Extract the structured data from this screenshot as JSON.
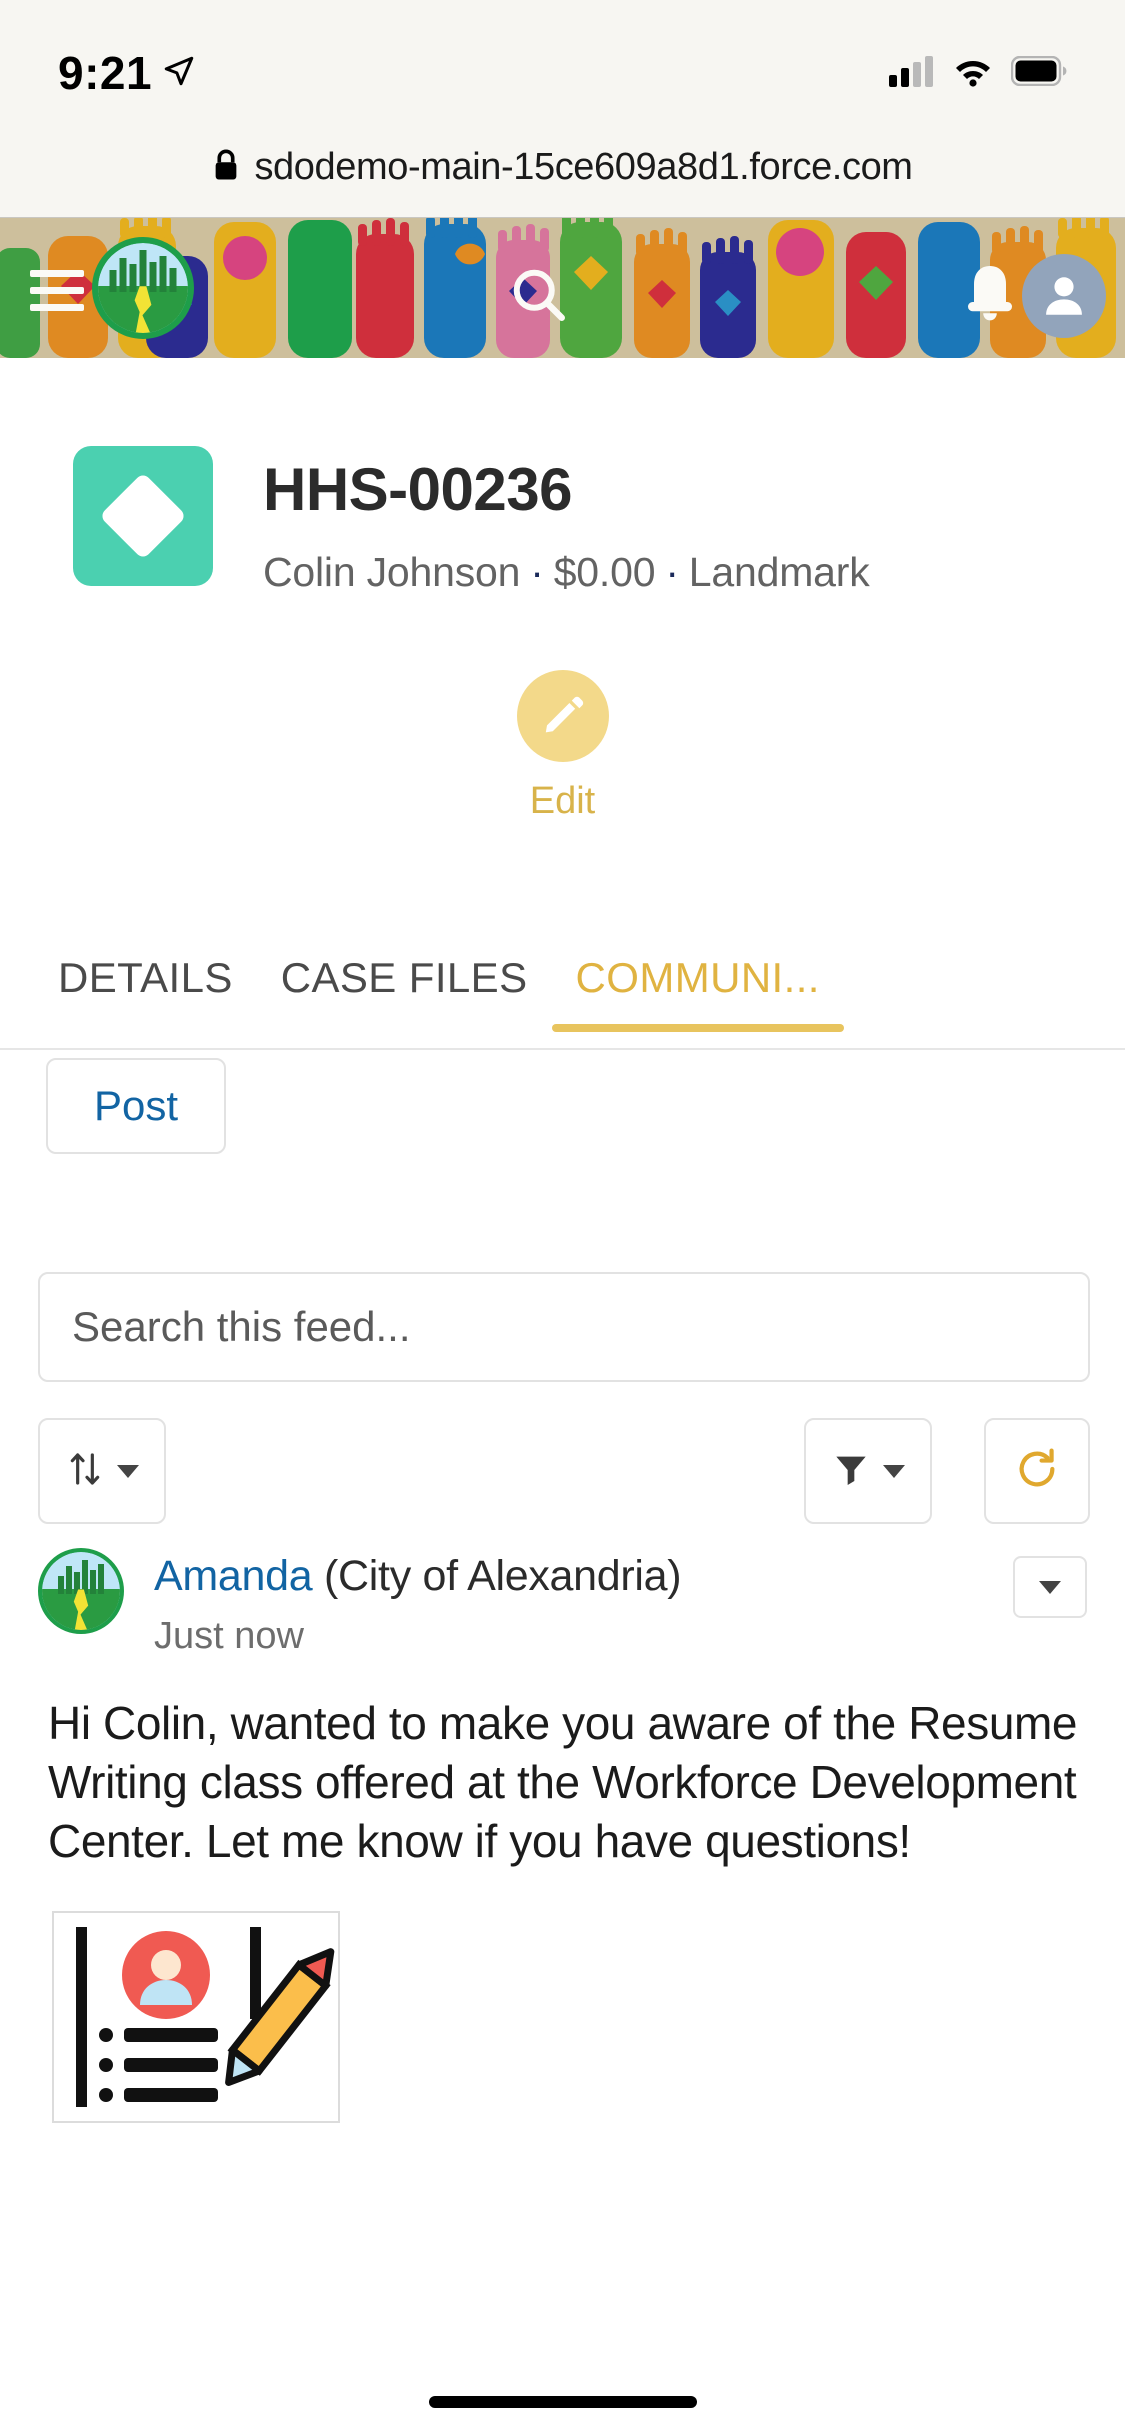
{
  "status_bar": {
    "time": "9:21",
    "location_icon": "location-arrow-icon",
    "signal_icon": "cellular-signal-icon",
    "wifi_icon": "wifi-icon",
    "battery_icon": "battery-full-icon"
  },
  "browser": {
    "lock_icon": "lock-icon",
    "url": "sdodemo-main-15ce609a8d1.force.com"
  },
  "community_header": {
    "background_color": "#cdbf9c",
    "menu_icon": "hamburger-menu-icon",
    "logo_name": "emerald-city-logo",
    "search_icon": "search-icon",
    "notifications_icon": "bell-icon",
    "profile_icon": "user-avatar-icon"
  },
  "record": {
    "icon_color": "#4bd0b0",
    "icon_name": "diamond-icon",
    "title": "HHS-00236",
    "subtitle_parts": [
      "Colin Johnson",
      "$0.00",
      "Landmark"
    ],
    "subtitle_separator": "·",
    "contact": "Colin Johnson",
    "amount": "$0.00",
    "program": "Landmark"
  },
  "actions": {
    "edit_label": "Edit",
    "edit_icon": "pencil-icon",
    "edit_button_color": "#f3d98a"
  },
  "tabs": [
    {
      "label": "DETAILS",
      "active": false
    },
    {
      "label": "CASE FILES",
      "active": false
    },
    {
      "label": "COMMUNI...",
      "active": true
    }
  ],
  "feed": {
    "post_button_label": "Post",
    "search_placeholder": "Search this feed...",
    "search_value": "",
    "sort_icon": "sort-arrows-icon",
    "sort_caret": "chevron-down-icon",
    "filter_icon": "filter-funnel-icon",
    "filter_caret": "chevron-down-icon",
    "refresh_icon": "refresh-icon",
    "refresh_color": "#e0a82e",
    "accent_color": "#e8c45e",
    "link_color": "#1264a3"
  },
  "post": {
    "author": "Amanda",
    "author_org": "(City of Alexandria)",
    "timestamp": "Just now",
    "menu_icon": "chevron-down-icon",
    "avatar_name": "emerald-city-avatar",
    "body": "Hi Colin, wanted to make you aware of the Resume Writing class offered at the Workforce Development Center. Let me know if you have questions!",
    "attachment_name": "resume-writing-thumbnail"
  }
}
